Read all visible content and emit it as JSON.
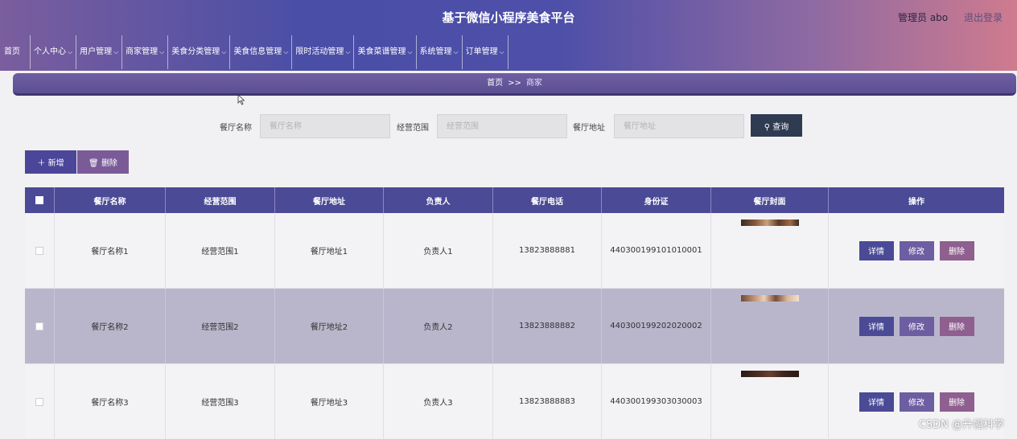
{
  "header": {
    "title": "基于微信小程序美食平台",
    "user": "管理员 abo",
    "logout": "退出登录"
  },
  "nav": [
    {
      "label": "首页",
      "dropdown": false
    },
    {
      "label": "个人中心",
      "dropdown": true
    },
    {
      "label": "用户管理",
      "dropdown": true
    },
    {
      "label": "商家管理",
      "dropdown": true
    },
    {
      "label": "美食分类管理",
      "dropdown": true
    },
    {
      "label": "美食信息管理",
      "dropdown": true
    },
    {
      "label": "限时活动管理",
      "dropdown": true
    },
    {
      "label": "美食菜谱管理",
      "dropdown": true
    },
    {
      "label": "系统管理",
      "dropdown": true
    },
    {
      "label": "订单管理",
      "dropdown": true
    }
  ],
  "breadcrumb": {
    "home": "首页",
    "sep": ">>",
    "current": "商家"
  },
  "search": {
    "name_label": "餐厅名称",
    "name_placeholder": "餐厅名称",
    "scope_label": "经营范围",
    "scope_placeholder": "经营范围",
    "addr_label": "餐厅地址",
    "addr_placeholder": "餐厅地址",
    "query_label": "查询"
  },
  "actions": {
    "add": "新增",
    "delete": "删除"
  },
  "table": {
    "columns": [
      "餐厅名称",
      "经营范围",
      "餐厅地址",
      "负责人",
      "餐厅电话",
      "身份证",
      "餐厅封面",
      "操作"
    ],
    "rows": [
      {
        "name": "餐厅名称1",
        "scope": "经营范围1",
        "addr": "餐厅地址1",
        "owner": "负责人1",
        "phone": "13823888881",
        "id": "440300199101010001"
      },
      {
        "name": "餐厅名称2",
        "scope": "经营范围2",
        "addr": "餐厅地址2",
        "owner": "负责人2",
        "phone": "13823888882",
        "id": "440300199202020002"
      },
      {
        "name": "餐厅名称3",
        "scope": "经营范围3",
        "addr": "餐厅地址3",
        "owner": "负责人3",
        "phone": "13823888883",
        "id": "440300199303030003"
      }
    ],
    "row_actions": {
      "detail": "详情",
      "edit": "修改",
      "delete": "删除"
    }
  },
  "watermark": "CSDN @升幅科学",
  "colors": {
    "primary": "#4a4a96",
    "accent": "#6d5ea2",
    "danger": "#8e5f8f",
    "query": "#2f3b51"
  }
}
